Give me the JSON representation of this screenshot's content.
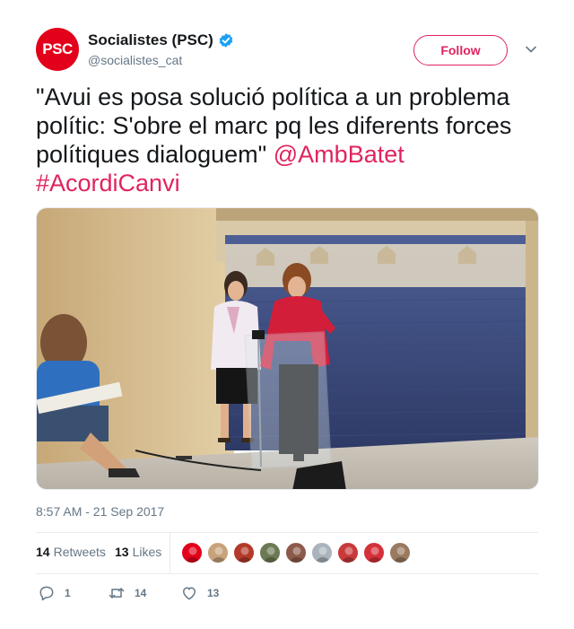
{
  "account": {
    "display_name": "Socialistes (PSC)",
    "handle": "@socialistes_cat",
    "avatar_text": "PSC",
    "verified": true
  },
  "follow_label": "Follow",
  "tweet": {
    "text_plain": "\"Avui es posa solució política a un problema polític: S'obre el marc pq les diferents forces polítiques dialoguem\" ",
    "mention": "@AmbBatet",
    "hashtag": "#AcordiCanvi"
  },
  "timestamp": "8:57 AM - 21 Sep 2017",
  "stats": {
    "retweets_count": "14",
    "retweets_label": "Retweets",
    "likes_count": "13",
    "likes_label": "Likes"
  },
  "likers": [
    {
      "name": "liker-1",
      "color": "#e2001a"
    },
    {
      "name": "liker-2",
      "color": "#c8a27a"
    },
    {
      "name": "liker-3",
      "color": "#b33a2a"
    },
    {
      "name": "liker-4",
      "color": "#6b7a55"
    },
    {
      "name": "liker-5",
      "color": "#8c5a4a"
    },
    {
      "name": "liker-6",
      "color": "#aab4bd"
    },
    {
      "name": "liker-7",
      "color": "#c83a3a"
    },
    {
      "name": "liker-8",
      "color": "#d4313a"
    },
    {
      "name": "liker-9",
      "color": "#9a7a60"
    }
  ],
  "actions": {
    "reply_count": "1",
    "retweet_count": "14",
    "like_count": "13"
  },
  "colors": {
    "accent": "#e0245e",
    "brand_red": "#e2001a",
    "verified_blue": "#1da1f2",
    "secondary_text": "#657786"
  },
  "icons": {
    "verified": "verified-badge-icon",
    "chevron": "chevron-down-icon",
    "reply": "reply-icon",
    "retweet": "retweet-icon",
    "like": "heart-icon"
  }
}
